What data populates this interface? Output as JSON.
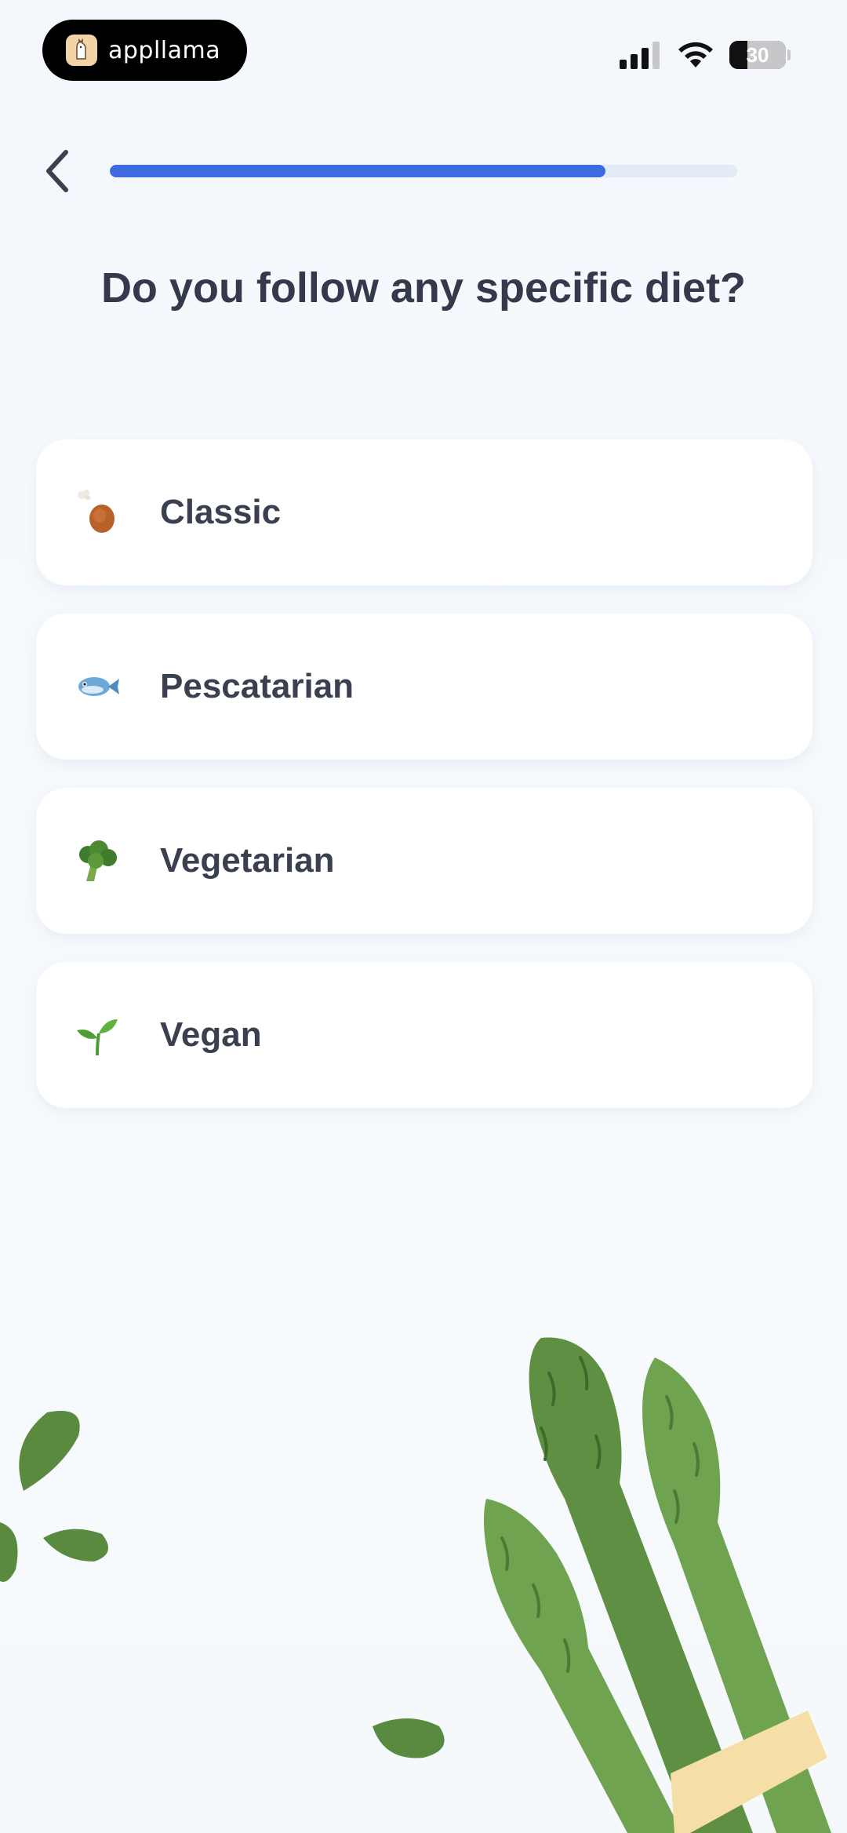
{
  "status_bar": {
    "app_pill_label": "appllama",
    "battery_level": "30"
  },
  "header": {
    "progress_percent": 79
  },
  "question": {
    "title": "Do you follow any specific diet?"
  },
  "options": [
    {
      "label": "Classic",
      "icon": "poultry-leg-icon"
    },
    {
      "label": "Pescatarian",
      "icon": "fish-icon"
    },
    {
      "label": "Vegetarian",
      "icon": "broccoli-icon"
    },
    {
      "label": "Vegan",
      "icon": "seedling-icon"
    }
  ],
  "colors": {
    "accent": "#3d6ae0",
    "title_text": "#343a4c",
    "card_bg": "#ffffff",
    "leaf_dark": "#5a8a3f",
    "leaf_light": "#6fa34f"
  }
}
